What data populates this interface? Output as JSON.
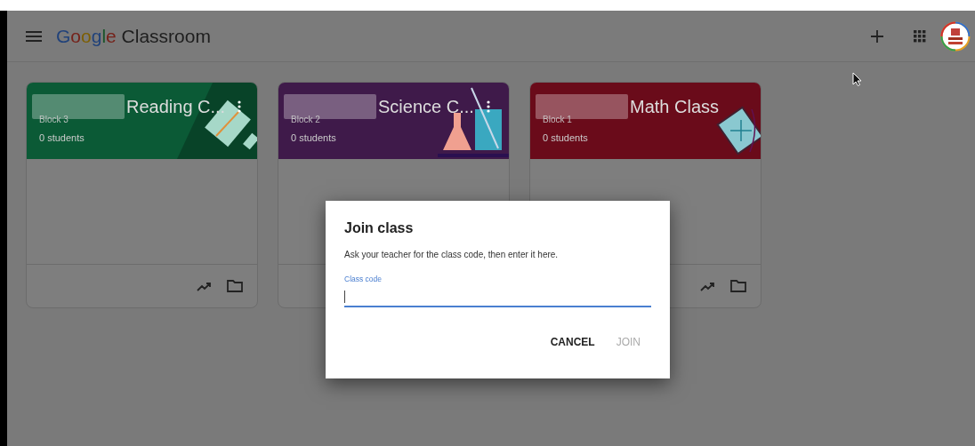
{
  "header": {
    "logo_brand": "Google",
    "logo_product": "Classroom"
  },
  "classes": [
    {
      "title": "Reading C...",
      "section": "Block 3",
      "students": "0 students",
      "color": "#0b5a36",
      "kind": "books"
    },
    {
      "title": "Science C...",
      "section": "Block 2",
      "students": "0 students",
      "color": "#3f1a4a",
      "kind": "flask"
    },
    {
      "title": "Math Class",
      "section": "Block 1",
      "students": "0 students",
      "color": "#6a0b1a",
      "kind": "graph"
    }
  ],
  "dialog": {
    "title": "Join class",
    "text": "Ask your teacher for the class code, then enter it here.",
    "field": {
      "label": "Class code",
      "focused": true
    },
    "buttons": [
      {
        "label": "CANCEL",
        "disabled": false
      },
      {
        "label": "JOIN",
        "disabled": true
      }
    ]
  }
}
